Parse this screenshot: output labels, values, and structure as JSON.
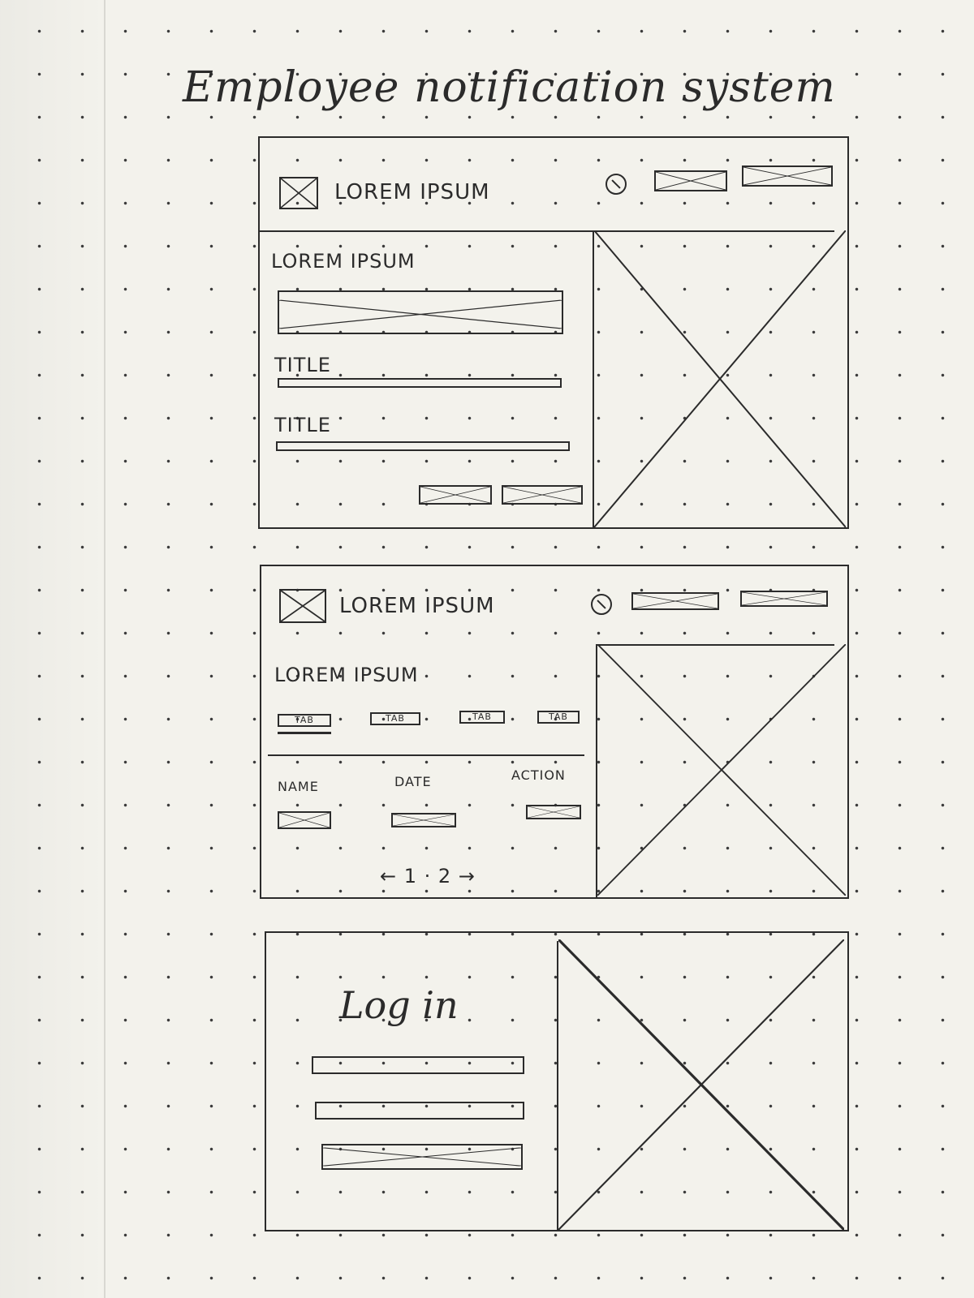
{
  "title": "Employee notification system",
  "wireframe_1": {
    "header_label": "LOREM IPSUM",
    "section_label": "LOREM IPSUM",
    "field_1_label": "TITLE",
    "field_2_label": "TITLE"
  },
  "wireframe_2": {
    "header_label": "LOREM IPSUM",
    "section_label": "LOREM IPSUM",
    "tabs": [
      "TAB",
      "TAB",
      "TAB",
      "TAB"
    ],
    "columns": [
      "NAME",
      "DATE",
      "ACTION"
    ],
    "pagination": "← 1 · 2 →"
  },
  "wireframe_3": {
    "login_title": "Log in"
  }
}
